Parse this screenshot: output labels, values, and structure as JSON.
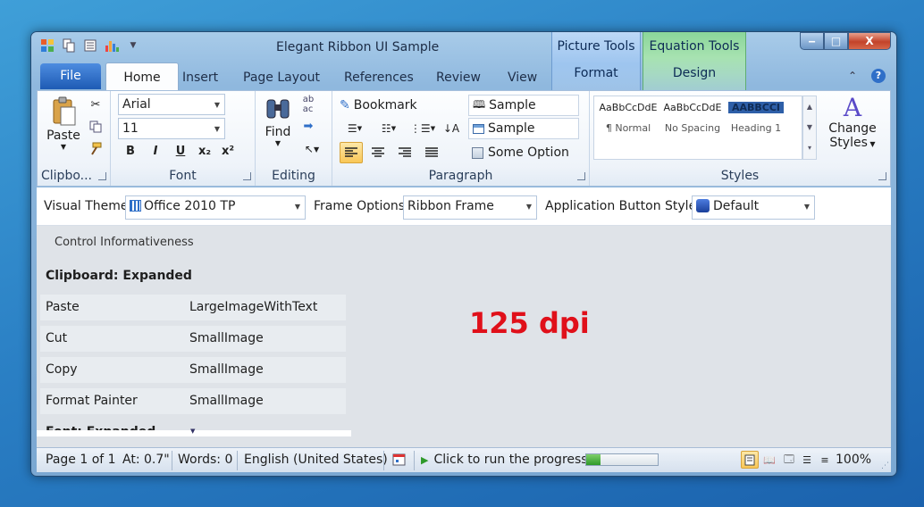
{
  "window": {
    "title": "Elegant Ribbon UI Sample",
    "contextual_tabs": [
      {
        "label": "Picture Tools",
        "tab": "Format"
      },
      {
        "label": "Equation Tools",
        "tab": "Design"
      }
    ],
    "buttons": {
      "minimize": "‒",
      "maximize": "□",
      "close": "X"
    }
  },
  "tabs": [
    "File",
    "Home",
    "Insert",
    "Page Layout",
    "References",
    "Review",
    "View"
  ],
  "ribbon": {
    "clipboard": {
      "label": "Clipbo...",
      "paste": "Paste"
    },
    "font": {
      "label": "Font",
      "family": "Arial",
      "size": "11",
      "format_buttons": [
        "B",
        "I",
        "U",
        "x₂",
        "x²"
      ]
    },
    "editing": {
      "label": "Editing",
      "find": "Find"
    },
    "paragraph": {
      "label": "Paragraph",
      "bookmark": "Bookmark",
      "sample1": "Sample",
      "sample2": "Sample",
      "some_option": "Some Option"
    },
    "styles": {
      "label": "Styles",
      "items": [
        {
          "preview": "AaBbCcDdE",
          "name": "¶ Normal"
        },
        {
          "preview": "AaBbCcDdE",
          "name": "No Spacing"
        },
        {
          "preview": "AABBCCI",
          "name": "Heading 1"
        }
      ],
      "change_styles": "Change",
      "change_styles2": "Styles"
    }
  },
  "options": {
    "visual_theme_label": "Visual Theme",
    "visual_theme_value": "Office 2010 TP",
    "frame_options_label": "Frame Options",
    "frame_options_value": "Ribbon Frame",
    "app_button_style_label": "Application Button Style",
    "app_button_style_value": "Default"
  },
  "content": {
    "header": "Control Informativeness",
    "section": "Clipboard: Expanded",
    "rows": [
      {
        "name": "Paste",
        "value": "LargeImageWithText"
      },
      {
        "name": "Cut",
        "value": "SmallImage"
      },
      {
        "name": "Copy",
        "value": "SmallImage"
      },
      {
        "name": "Format Painter",
        "value": "SmallImage"
      }
    ],
    "next_section": "Font: Expanded",
    "dpi": "125 dpi"
  },
  "status": {
    "page": "Page 1 of 1",
    "at": "At: 0.7\"",
    "words": "Words: 0",
    "language": "English (United States)",
    "run_progress": "Click to run the progress",
    "progress": 0.2,
    "zoom": "100%"
  },
  "colors": {
    "accent": "#1e5bb4",
    "dpi_text": "#e0101a",
    "picture_tools": "#9ec5ef",
    "equation_tools": "#8ad69a"
  }
}
